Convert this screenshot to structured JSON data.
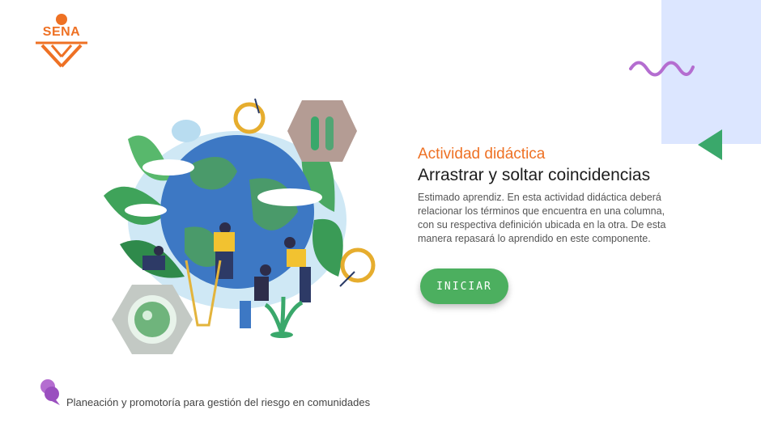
{
  "brand": {
    "logo_text": "SENA",
    "logo_color": "#ee7124"
  },
  "activity": {
    "subtitle": "Actividad didáctica",
    "title": "Arrastrar y soltar coincidencias",
    "description": "Estimado aprendiz.  En esta actividad didáctica deberá relacionar los términos que encuentra en una columna, con su respectiva definición ubicada en la otra.  De esta manera repasará lo aprendido en este componente."
  },
  "start_button": {
    "label": "INICIAR",
    "color": "#4caf5f"
  },
  "footer": {
    "program": "Planeación y promotoría para gestión del riesgo en comunidades"
  },
  "colors": {
    "accent_orange": "#ee7124",
    "panel_blue": "#dce6ff",
    "wave_purple": "#b46dd0",
    "triangle_green": "#3aa86b"
  },
  "icons": [
    "sena-logo-icon",
    "wave-decoration-icon",
    "triangle-decoration-icon",
    "earth-illustration",
    "chat-bubble-icon"
  ]
}
